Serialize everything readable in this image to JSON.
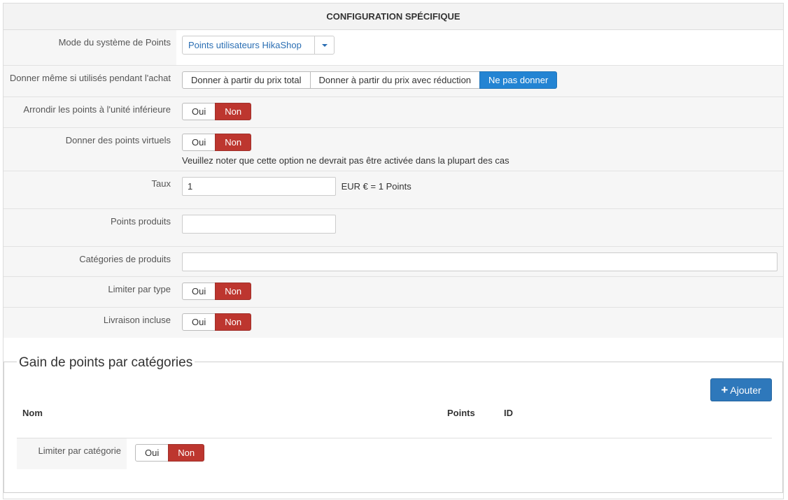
{
  "header": {
    "title": "CONFIGURATION SPÉCIFIQUE"
  },
  "rows": {
    "mode": {
      "label": "Mode du système de Points",
      "select_value": "Points utilisateurs HikaShop"
    },
    "give_even": {
      "label": "Donner même si utilisés pendant l'achat",
      "options": [
        "Donner à partir du prix total",
        "Donner à partir du prix avec réduction",
        "Ne pas donner"
      ],
      "selected": "Ne pas donner"
    },
    "round": {
      "label": "Arrondir les points à l'unité inférieure",
      "yes": "Oui",
      "no": "Non",
      "selected": "Non"
    },
    "virtual": {
      "label": "Donner des points virtuels",
      "yes": "Oui",
      "no": "Non",
      "selected": "Non",
      "note": "Veuillez noter que cette option ne devrait pas être activée dans la plupart des cas"
    },
    "rate": {
      "label": "Taux",
      "value": "1",
      "suffix": "EUR € = 1 Points"
    },
    "product_points": {
      "label": "Points produits",
      "value": ""
    },
    "product_categories": {
      "label": "Catégories de produits",
      "value": ""
    },
    "limit_type": {
      "label": "Limiter par type",
      "yes": "Oui",
      "no": "Non",
      "selected": "Non"
    },
    "shipping": {
      "label": "Livraison incluse",
      "yes": "Oui",
      "no": "Non",
      "selected": "Non"
    }
  },
  "category_gain": {
    "legend": "Gain de points par catégories",
    "add_label": "Ajouter",
    "columns": {
      "name": "Nom",
      "points": "Points",
      "id": "ID"
    },
    "limit": {
      "label": "Limiter par catégorie",
      "yes": "Oui",
      "no": "Non",
      "selected": "Non"
    }
  },
  "colors": {
    "red": "#bd362f",
    "blue": "#2384d3",
    "primary": "#2e78bb"
  }
}
